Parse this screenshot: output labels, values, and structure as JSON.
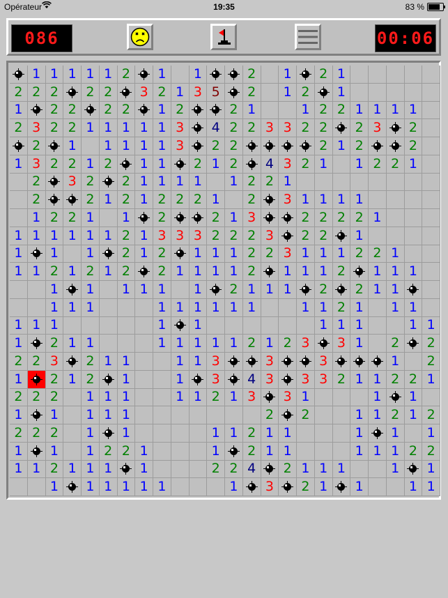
{
  "status_bar": {
    "carrier": "Opérateur",
    "time": "19:35",
    "battery": "83 %"
  },
  "toolbar": {
    "mine_counter": "086",
    "timer": "00:06",
    "face_icon": "dead-face-icon",
    "flag_icon": "flag-icon",
    "menu_icon": "hamburger-menu-icon"
  },
  "colors": {
    "n1": "#0000ff",
    "n2": "#008000",
    "n3": "#ff0000",
    "n4": "#000080",
    "n5": "#800000",
    "lcd_text": "#ff1a1a",
    "exploded": "#ff0000",
    "face_yellow": "#ffff00"
  },
  "board": {
    "cols": 24,
    "rows": 24,
    "legend": "* = mine, X = exploded mine, . = empty, digit = adjacent count",
    "cells": [
      "*11111 2*1.1**2.1*21....",
      "222*22*3213 5*2.12*1....",
      "1*22*22*12**21..122111 1",
      "23221111 13*422332 2*23*2",
      "*2*1.11113*22****21 2**2",
      "13221 2*11*212*4321.1221",
      ".2*32*21111.1221........",
      ".2**212122 21.2*31111...",
      ".1221.1*2**21 3**2 2221.",
      "1111 1121333 2223*22*1..",
      "1*1.1*212*1112 2311 1221.",
      "1121212*2111 12*1112*111",
      "..1*1.111.1*2111*2*211*",
      "..111...11 1111..1121.11",
      "111.....1*1......111..11",
      "1*211...1111 1212 3*31.2*2",
      "223*211..113**3**3***1.2*2",
      "1X212*1..1*3*43*332112 21",
      "222.111..11213*31...1*1",
      "1*1.111.......2*2..1121 21",
      "222.1*1....1121 1...1*1.1*",
      "1*1.1221...1*211...11122",
      "11211 1*1...22 4*2111..1*1",
      "..1*1111 1...1*3*2 1*1..11"
    ]
  }
}
